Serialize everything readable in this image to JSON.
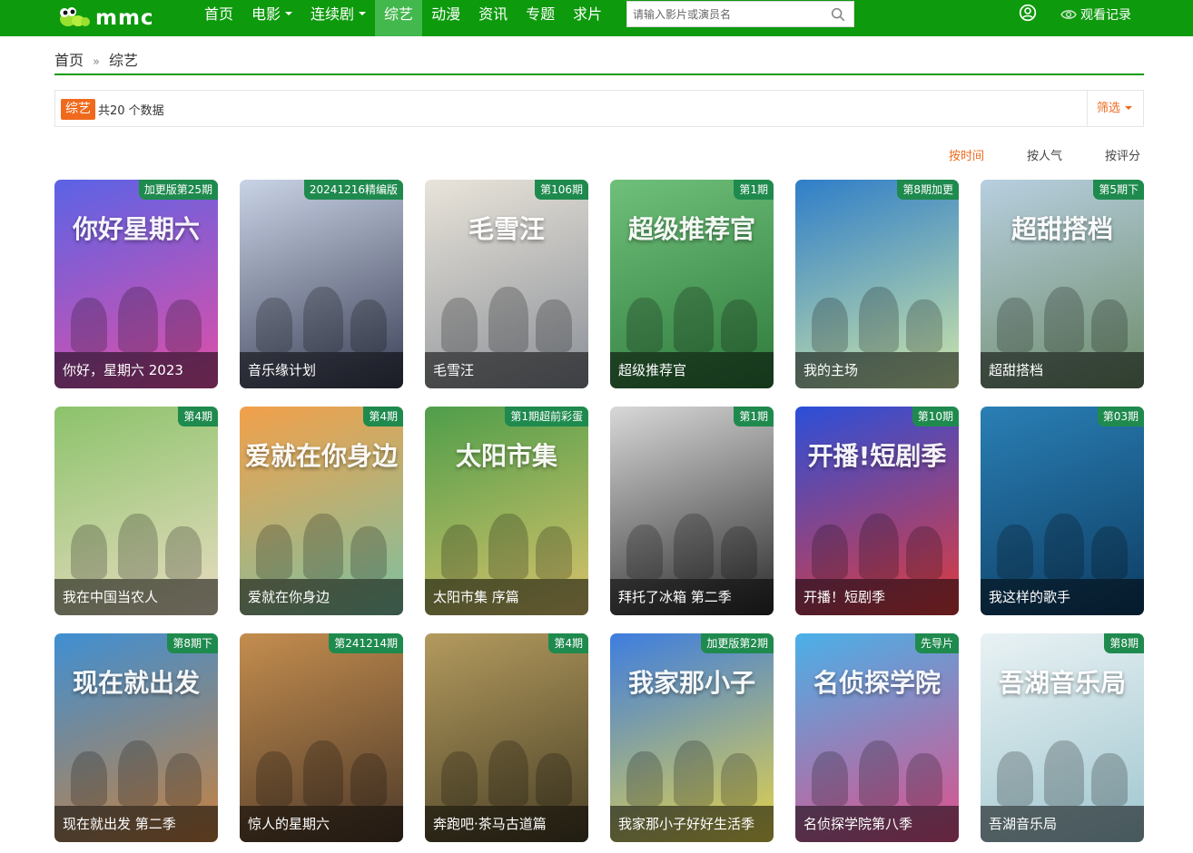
{
  "header": {
    "logo_text": "mmc",
    "nav": [
      {
        "label": "首页",
        "dropdown": false,
        "active": false
      },
      {
        "label": "电影",
        "dropdown": true,
        "active": false
      },
      {
        "label": "连续剧",
        "dropdown": true,
        "active": false
      },
      {
        "label": "综艺",
        "dropdown": false,
        "active": true
      },
      {
        "label": "动漫",
        "dropdown": false,
        "active": false
      },
      {
        "label": "资讯",
        "dropdown": false,
        "active": false
      },
      {
        "label": "专题",
        "dropdown": false,
        "active": false
      },
      {
        "label": "求片",
        "dropdown": false,
        "active": false
      }
    ],
    "search_placeholder": "请输入影片或演员名",
    "history_label": "观看记录",
    "icons": {
      "search": "search-icon",
      "user": "user-icon",
      "history": "eye-icon"
    }
  },
  "breadcrumb": {
    "home": "首页",
    "separator": "»",
    "current": "综艺"
  },
  "filter": {
    "category": "综艺",
    "count_text": "共20 个数据",
    "filter_label": "筛选"
  },
  "sort": {
    "by_time": "按时间",
    "by_popularity": "按人气",
    "by_rating": "按评分",
    "active": "by_time"
  },
  "colors": {
    "brand": "#0d9a0d",
    "nav_active": "#43b84d",
    "accent": "#ef6a1d",
    "badge": "#1f8a4e"
  },
  "items": [
    {
      "title": "你好，星期六 2023",
      "badge": "加更版第25期",
      "poster_text": "你好星期六",
      "c1": "#5b63e6",
      "c2": "#e24fa6"
    },
    {
      "title": "音乐缘计划",
      "badge": "20241216精编版",
      "poster_text": "",
      "c1": "#c9d3e6",
      "c2": "#3a3f55"
    },
    {
      "title": "毛雪汪",
      "badge": "第106期",
      "poster_text": "毛雪汪",
      "c1": "#e9e4da",
      "c2": "#8a8f97"
    },
    {
      "title": "超级推荐官",
      "badge": "第1期",
      "poster_text": "超级推荐官",
      "c1": "#6fc07a",
      "c2": "#2e7a3c"
    },
    {
      "title": "我的主场",
      "badge": "第8期加更",
      "poster_text": "",
      "c1": "#2f7ec9",
      "c2": "#cfe6a8"
    },
    {
      "title": "超甜搭档",
      "badge": "第5期下",
      "poster_text": "超甜搭档",
      "c1": "#b7cfe0",
      "c2": "#6d8c6a"
    },
    {
      "title": "我在中国当农人",
      "badge": "第4期",
      "poster_text": "",
      "c1": "#8cc36b",
      "c2": "#e9dcc2"
    },
    {
      "title": "爱就在你身边",
      "badge": "第4期",
      "poster_text": "爱就在你身边",
      "c1": "#f2a04a",
      "c2": "#7cc1a2"
    },
    {
      "title": "太阳市集 序篇",
      "badge": "第1期超前彩蛋",
      "poster_text": "太阳市集",
      "c1": "#4f9e4a",
      "c2": "#d9c26b"
    },
    {
      "title": "拜托了冰箱 第二季",
      "badge": "第1期",
      "poster_text": "",
      "c1": "#d8d8d8",
      "c2": "#2b2b2b"
    },
    {
      "title": "开播！短剧季",
      "badge": "第10期",
      "poster_text": "开播!短剧季",
      "c1": "#2b4fd9",
      "c2": "#e23b3b"
    },
    {
      "title": "我这样的歌手",
      "badge": "第03期",
      "poster_text": "",
      "c1": "#2a7fb5",
      "c2": "#0d3d63"
    },
    {
      "title": "现在就出发 第二季",
      "badge": "第8期下",
      "poster_text": "现在就出发",
      "c1": "#3f8fd3",
      "c2": "#c7813f"
    },
    {
      "title": "惊人的星期六",
      "badge": "第241214期",
      "poster_text": "",
      "c1": "#c48d4e",
      "c2": "#4d3a2a"
    },
    {
      "title": "奔跑吧·茶马古道篇",
      "badge": "第4期",
      "poster_text": "",
      "c1": "#b39a5e",
      "c2": "#4a4126"
    },
    {
      "title": "我家那小子好好生活季",
      "badge": "加更版第2期",
      "poster_text": "我家那小子",
      "c1": "#3d7de0",
      "c2": "#e5d34a"
    },
    {
      "title": "名侦探学院第八季",
      "badge": "先导片",
      "poster_text": "名侦探学院",
      "c1": "#4ab0e8",
      "c2": "#e0508a"
    },
    {
      "title": "吾湖音乐局",
      "badge": "第8期",
      "poster_text": "吾湖音乐局",
      "c1": "#e9f2f4",
      "c2": "#9fc6cf"
    }
  ]
}
